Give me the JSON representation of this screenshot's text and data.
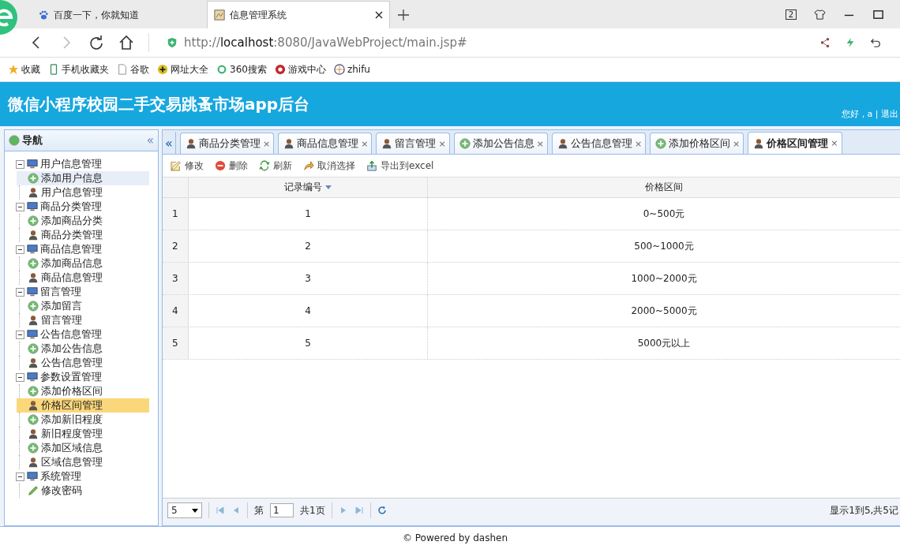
{
  "browser": {
    "tabs": [
      {
        "title": "百度一下，你就知道",
        "kind": "paw",
        "selected": false
      },
      {
        "title": "信息管理系统",
        "kind": "page",
        "selected": true
      }
    ],
    "tab_count": "2",
    "url_host": "localhost",
    "url_prefix": "http://",
    "url_rest": ":8080/JavaWebProject/main.jsp#",
    "bookmarks": [
      {
        "label": "收藏",
        "kind": "star"
      },
      {
        "label": "手机收藏夹",
        "kind": "phone"
      },
      {
        "label": "谷歌",
        "kind": "doc"
      },
      {
        "label": "网址大全",
        "kind": "plus"
      },
      {
        "label": "360搜索",
        "kind": "search"
      },
      {
        "label": "游戏中心",
        "kind": "game"
      },
      {
        "label": "zhifu",
        "kind": "globe"
      }
    ]
  },
  "header": {
    "title": "微信小程序校园二手交易跳蚤市场app后台",
    "user": "您好，a | 退出"
  },
  "sidebar": {
    "title": "导航",
    "collapse": "«",
    "items": [
      {
        "label": "用户信息管理",
        "expanded": true,
        "children": [
          {
            "label": "添加用户信息",
            "kind": "add",
            "selected": false,
            "hover": true
          },
          {
            "label": "用户信息管理",
            "kind": "user",
            "selected": false,
            "hover": false
          }
        ]
      },
      {
        "label": "商品分类管理",
        "expanded": true,
        "children": [
          {
            "label": "添加商品分类",
            "kind": "add",
            "selected": false,
            "hover": false
          },
          {
            "label": "商品分类管理",
            "kind": "user",
            "selected": false,
            "hover": false
          }
        ]
      },
      {
        "label": "商品信息管理",
        "expanded": true,
        "children": [
          {
            "label": "添加商品信息",
            "kind": "add",
            "selected": false,
            "hover": false
          },
          {
            "label": "商品信息管理",
            "kind": "user",
            "selected": false,
            "hover": false
          }
        ]
      },
      {
        "label": "留言管理",
        "expanded": true,
        "children": [
          {
            "label": "添加留言",
            "kind": "add",
            "selected": false,
            "hover": false
          },
          {
            "label": "留言管理",
            "kind": "user",
            "selected": false,
            "hover": false
          }
        ]
      },
      {
        "label": "公告信息管理",
        "expanded": true,
        "children": [
          {
            "label": "添加公告信息",
            "kind": "add",
            "selected": false,
            "hover": false
          },
          {
            "label": "公告信息管理",
            "kind": "user",
            "selected": false,
            "hover": false
          }
        ]
      },
      {
        "label": "参数设置管理",
        "expanded": true,
        "children": [
          {
            "label": "添加价格区间",
            "kind": "add",
            "selected": false,
            "hover": false
          },
          {
            "label": "价格区间管理",
            "kind": "user",
            "selected": true,
            "hover": false
          },
          {
            "label": "添加新旧程度",
            "kind": "add",
            "selected": false,
            "hover": false
          },
          {
            "label": "新旧程度管理",
            "kind": "user",
            "selected": false,
            "hover": false
          },
          {
            "label": "添加区域信息",
            "kind": "add",
            "selected": false,
            "hover": false
          },
          {
            "label": "区域信息管理",
            "kind": "user",
            "selected": false,
            "hover": false
          }
        ]
      },
      {
        "label": "系统管理",
        "expanded": true,
        "children": [
          {
            "label": "修改密码",
            "kind": "pencil",
            "selected": false,
            "hover": false
          }
        ]
      }
    ]
  },
  "tabs": {
    "scroll_left": "«",
    "items": [
      {
        "label": "商品分类管理",
        "kind": "user",
        "selected": false
      },
      {
        "label": "商品信息管理",
        "kind": "user",
        "selected": false
      },
      {
        "label": "留言管理",
        "kind": "user",
        "selected": false
      },
      {
        "label": "添加公告信息",
        "kind": "add",
        "selected": false
      },
      {
        "label": "公告信息管理",
        "kind": "user",
        "selected": false
      },
      {
        "label": "添加价格区间",
        "kind": "add",
        "selected": false
      },
      {
        "label": "价格区间管理",
        "kind": "user",
        "selected": true
      }
    ],
    "close": "×"
  },
  "toolbar": [
    {
      "label": "修改",
      "kind": "edit"
    },
    {
      "label": "删除",
      "kind": "delete"
    },
    {
      "label": "刷新",
      "kind": "refresh"
    },
    {
      "label": "取消选择",
      "kind": "undo"
    },
    {
      "label": "导出到excel",
      "kind": "export"
    }
  ],
  "table": {
    "columns": [
      "记录编号",
      "价格区间"
    ],
    "rows": [
      {
        "num": "1",
        "cells": [
          "1",
          "0~500元"
        ]
      },
      {
        "num": "2",
        "cells": [
          "2",
          "500~1000元"
        ]
      },
      {
        "num": "3",
        "cells": [
          "3",
          "1000~2000元"
        ]
      },
      {
        "num": "4",
        "cells": [
          "4",
          "2000~5000元"
        ]
      },
      {
        "num": "5",
        "cells": [
          "5",
          "5000元以上"
        ]
      }
    ]
  },
  "pager": {
    "page_size": "5",
    "page_label": "第",
    "page": "1",
    "total_pages": "共1页",
    "summary": "显示1到5,共5记"
  },
  "footer": "© Powered by dashen"
}
